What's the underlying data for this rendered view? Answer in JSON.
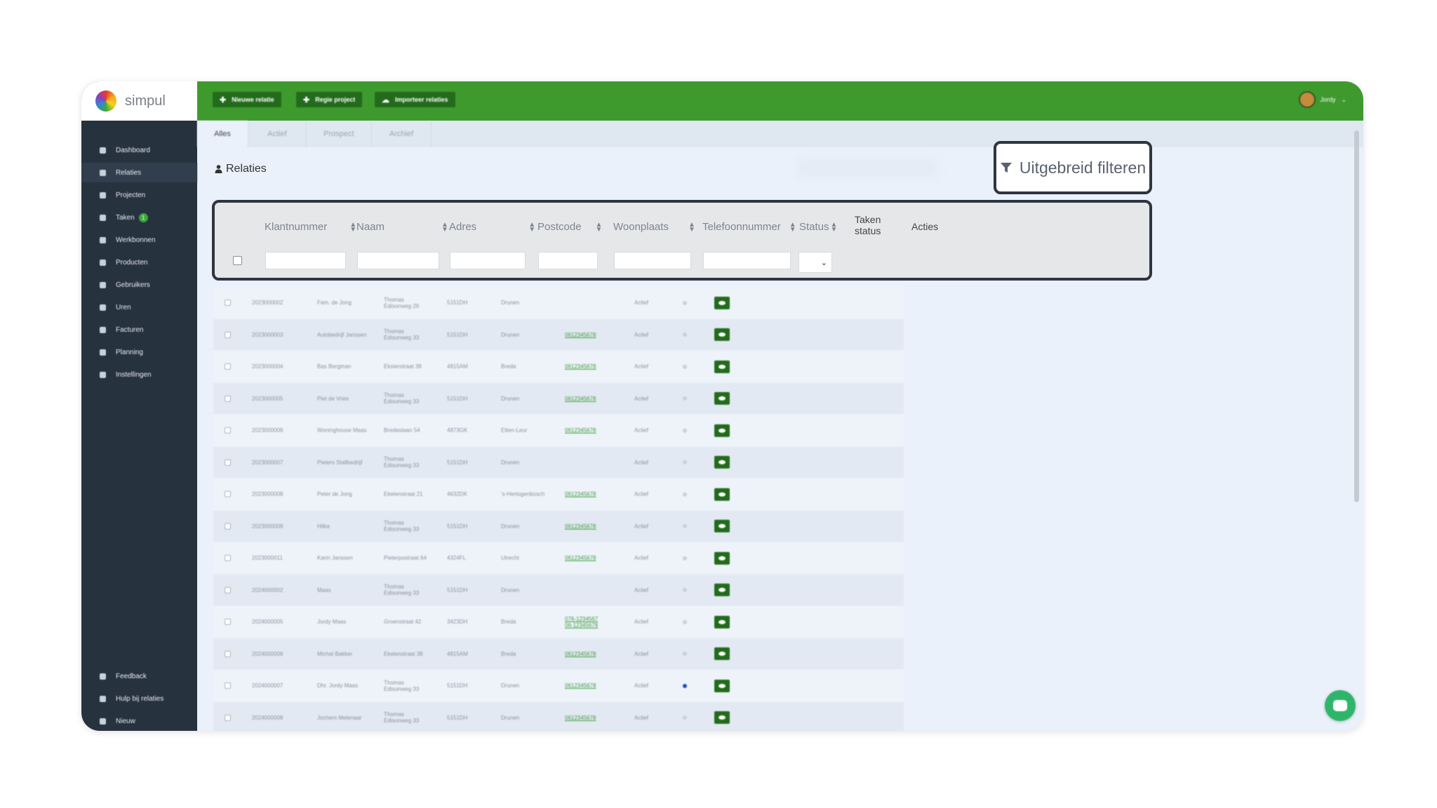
{
  "brand": {
    "name": "simpul"
  },
  "topbar": {
    "buttons": [
      {
        "label": "Nieuwe relatie",
        "icon": "plus-icon"
      },
      {
        "label": "Regie project",
        "icon": "plus-icon"
      },
      {
        "label": "Importeer relaties",
        "icon": "cloud-upload-icon"
      }
    ],
    "user": "Jordy"
  },
  "sidebar": {
    "items": [
      {
        "label": "Dashboard",
        "icon": "home-icon"
      },
      {
        "label": "Relaties",
        "icon": "user-icon",
        "active": true
      },
      {
        "label": "Projecten",
        "icon": "briefcase-icon"
      },
      {
        "label": "Taken",
        "icon": "task-icon",
        "badge": "1"
      },
      {
        "label": "Werkbonnen",
        "icon": "clipboard-icon"
      },
      {
        "label": "Producten",
        "icon": "box-icon"
      },
      {
        "label": "Gebruikers",
        "icon": "users-icon"
      },
      {
        "label": "Uren",
        "icon": "clock-icon"
      },
      {
        "label": "Facturen",
        "icon": "invoice-icon"
      },
      {
        "label": "Planning",
        "icon": "calendar-icon"
      },
      {
        "label": "Instellingen",
        "icon": "gear-icon"
      }
    ],
    "bottom_items": [
      {
        "label": "Feedback",
        "icon": "feedback-icon"
      },
      {
        "label": "Hulp bij relaties",
        "icon": "help-icon"
      },
      {
        "label": "Nieuw",
        "icon": "megaphone-icon"
      }
    ]
  },
  "tabs": [
    {
      "label": "Alles",
      "active": true
    },
    {
      "label": "Actief"
    },
    {
      "label": "Prospect"
    },
    {
      "label": "Archief"
    }
  ],
  "page": {
    "title": "Relaties"
  },
  "filter_button": {
    "label": "Uitgebreid filteren"
  },
  "table": {
    "columns": {
      "klantnummer": "Klantnummer",
      "naam": "Naam",
      "adres": "Adres",
      "postcode": "Postcode",
      "woonplaats": "Woonplaats",
      "telefoon": "Telefoonnummer",
      "status": "Status",
      "taken_status_1": "Taken",
      "taken_status_2": "status",
      "acties": "Acties"
    },
    "rows": [
      {
        "nr": "2023000002",
        "naam": "Fam. de Jong",
        "adres1": "Thomas",
        "adres2": "Edisonweg 26",
        "postcode": "5151DH",
        "plaats": "Drunen",
        "tel1": "",
        "tel2": "",
        "status": "Actief",
        "dot": "grey"
      },
      {
        "nr": "2023000003",
        "naam": "Autobedrijf Janssen",
        "adres1": "Thomas",
        "adres2": "Edisonweg 33",
        "postcode": "5151DH",
        "plaats": "Drunen",
        "tel1": "0612345678",
        "tel2": "",
        "status": "Actief",
        "dot": "grey"
      },
      {
        "nr": "2023000004",
        "naam": "Bas Bergman",
        "adres1": "Eksterstraat 38",
        "adres2": "",
        "postcode": "4815AM",
        "plaats": "Breda",
        "tel1": "0612345678",
        "tel2": "",
        "status": "Actief",
        "dot": "grey"
      },
      {
        "nr": "2023000005",
        "naam": "Piet de Vries",
        "adres1": "Thomas",
        "adres2": "Edisonweg 33",
        "postcode": "5151DH",
        "plaats": "Drunen",
        "tel1": "0612345678",
        "tel2": "",
        "status": "Actief",
        "dot": "grey"
      },
      {
        "nr": "2023000006",
        "naam": "Woninghouse Maas",
        "adres1": "Bredaslaan 54",
        "adres2": "",
        "postcode": "4873GK",
        "plaats": "Etten-Leur",
        "tel1": "0612345678",
        "tel2": "",
        "status": "Actief",
        "dot": "grey"
      },
      {
        "nr": "2023000007",
        "naam": "Pieters Stallbedrijf",
        "adres1": "Thomas",
        "adres2": "Edisonweg 33",
        "postcode": "5151DH",
        "plaats": "Drunen",
        "tel1": "",
        "tel2": "",
        "status": "Actief",
        "dot": "grey"
      },
      {
        "nr": "2023000008",
        "naam": "Peter de Jong",
        "adres1": "Ekelenstraat 21",
        "adres2": "",
        "postcode": "4632DK",
        "plaats": "'s-Hertogenbosch",
        "tel1": "0612345678",
        "tel2": "",
        "status": "Actief",
        "dot": "grey"
      },
      {
        "nr": "2023000009",
        "naam": "Hilka",
        "adres1": "Thomas",
        "adres2": "Edisonweg 33",
        "postcode": "5151DH",
        "plaats": "Drunen",
        "tel1": "0612345678",
        "tel2": "",
        "status": "Actief",
        "dot": "grey"
      },
      {
        "nr": "2023000011",
        "naam": "Karin Janssen",
        "adres1": "Pieterpostraat 64",
        "adres2": "",
        "postcode": "4324FL",
        "plaats": "Utrecht",
        "tel1": "0612345678",
        "tel2": "",
        "status": "Actief",
        "dot": "grey"
      },
      {
        "nr": "2024000002",
        "naam": "Maas",
        "adres1": "Thomas",
        "adres2": "Edisonweg 33",
        "postcode": "5151DH",
        "plaats": "Drunen",
        "tel1": "",
        "tel2": "",
        "status": "Actief",
        "dot": "grey"
      },
      {
        "nr": "2024000005",
        "naam": "Jordy Maas",
        "adres1": "Groenstraat 42",
        "adres2": "",
        "postcode": "3423DH",
        "plaats": "Breda",
        "tel1": "076-1234567",
        "tel2": "06-12345678",
        "status": "Actief",
        "dot": "grey"
      },
      {
        "nr": "2024000006",
        "naam": "Michal Bakker",
        "adres1": "Ekelenstraat 38",
        "adres2": "",
        "postcode": "4815AM",
        "plaats": "Breda",
        "tel1": "0612345678",
        "tel2": "",
        "status": "Actief",
        "dot": "grey"
      },
      {
        "nr": "2024000007",
        "naam": "Dhr. Jordy Maas",
        "adres1": "Thomas",
        "adres2": "Edisonweg 33",
        "postcode": "5151DH",
        "plaats": "Drunen",
        "tel1": "0612345678",
        "tel2": "",
        "status": "Actief",
        "dot": "blue"
      },
      {
        "nr": "2024000008",
        "naam": "Jochem Melenaar",
        "adres1": "Thomas",
        "adres2": "Edisonweg 33",
        "postcode": "5151DH",
        "plaats": "Drunen",
        "tel1": "0612345678",
        "tel2": "",
        "status": "Actief",
        "dot": "grey"
      }
    ]
  },
  "colors": {
    "topbar": "#3f9a2e",
    "sidebar": "#27323f",
    "action": "#226b1b"
  }
}
